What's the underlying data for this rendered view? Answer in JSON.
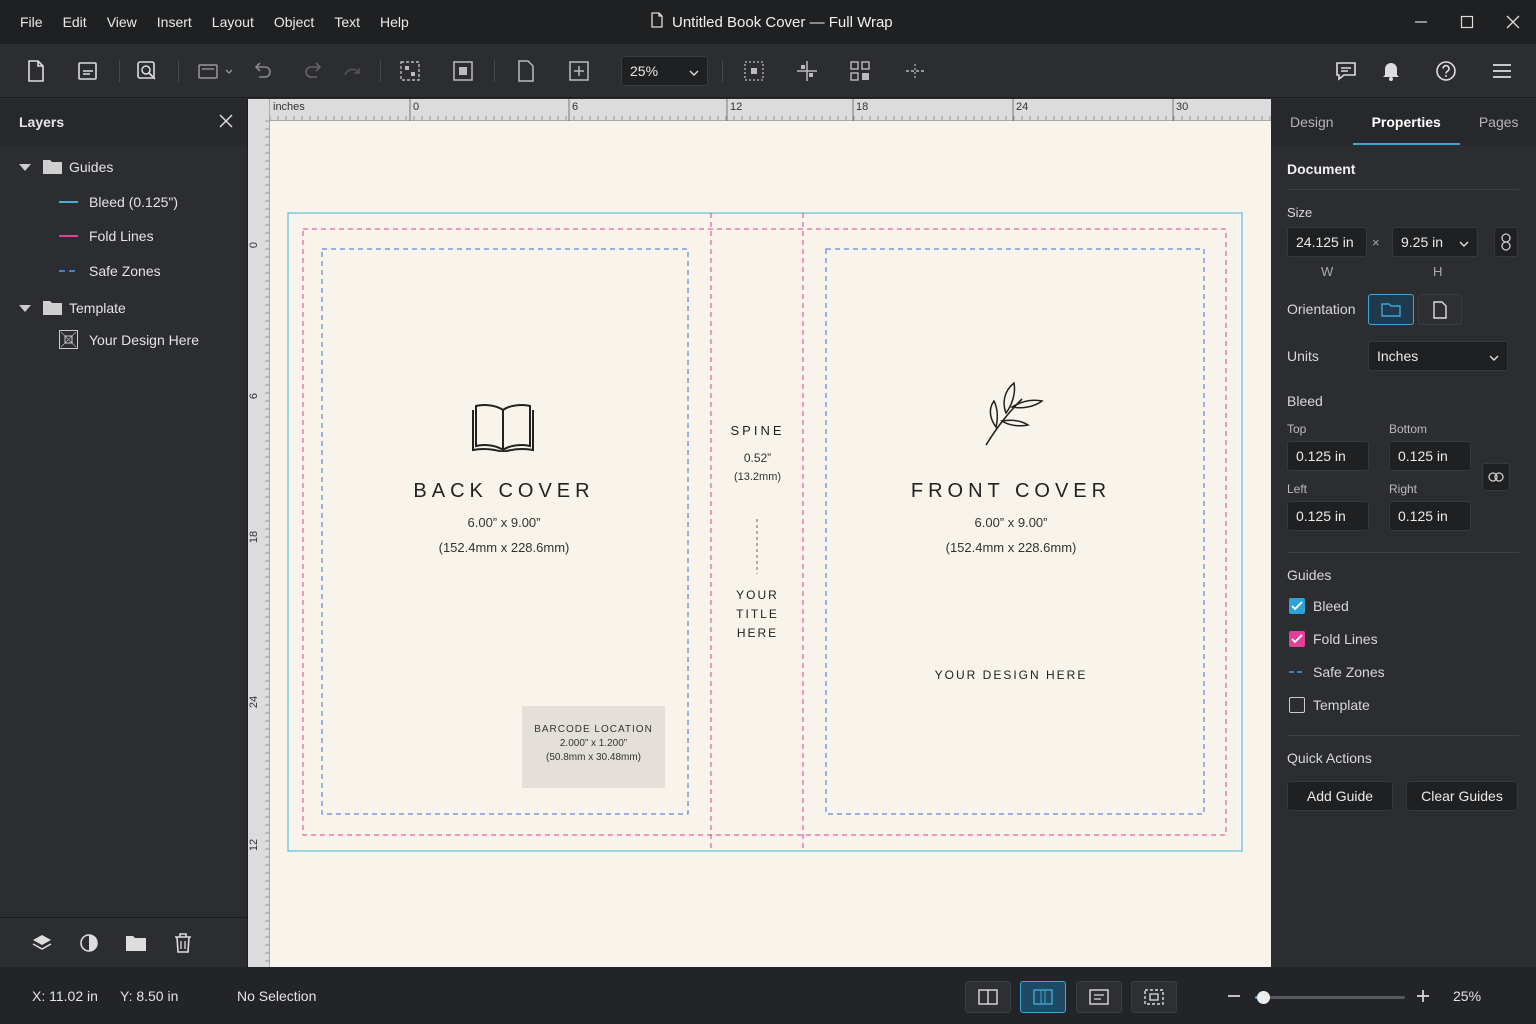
{
  "menu": [
    "File",
    "Edit",
    "View",
    "Insert",
    "Layout",
    "Object",
    "Text",
    "Help"
  ],
  "window": {
    "title": "Untitled Book Cover — Full Wrap"
  },
  "toolbar": {
    "zoom": "25%"
  },
  "layers": {
    "title": "Layers",
    "groups": [
      {
        "name": "Guides",
        "children": [
          "Bleed (0.125\")",
          "Fold Lines",
          "Safe Zones"
        ]
      },
      {
        "name": "Template",
        "children": [
          "Your Design Here"
        ]
      }
    ]
  },
  "ruler": {
    "unit": "inches",
    "top_ticks": [
      "0",
      "6",
      "12",
      "18",
      "24",
      "30"
    ],
    "left_ticks": [
      "0",
      "6",
      "18",
      "24",
      "12"
    ]
  },
  "canvas": {
    "back": {
      "title": "BACK COVER",
      "size": "6.00” x 9.00”",
      "mm": "(152.4mm x 228.6mm)"
    },
    "spine": {
      "title": "SPINE",
      "size": "0.52”",
      "mm": "(13.2mm)",
      "title_lines": [
        "YOUR",
        "TITLE",
        "HERE"
      ]
    },
    "front": {
      "title": "FRONT COVER",
      "size": "6.00” x 9.00”",
      "mm": "(152.4mm x 228.6mm)",
      "design": "YOUR DESIGN HERE"
    },
    "barcode": {
      "title": "BARCODE LOCATION",
      "size": "2.000” x 1.200”",
      "mm": "(50.8mm x 30.48mm)"
    }
  },
  "props": {
    "tabs": [
      "Design",
      "Properties",
      "Pages"
    ],
    "active_tab": "Properties",
    "document_title": "Document",
    "size_label": "Size",
    "width": "24.125 in",
    "height": "9.25 in",
    "w_label": "W",
    "h_label": "H",
    "orientation_label": "Orientation",
    "units_label": "Units",
    "units": "Inches",
    "bleed_title": "Bleed",
    "bleed": {
      "top_label": "Top",
      "top": "0.125 in",
      "bottom_label": "Bottom",
      "bottom": "0.125 in",
      "left_label": "Left",
      "left": "0.125 in",
      "right_label": "Right",
      "right": "0.125 in"
    },
    "guides_title": "Guides",
    "guides": [
      {
        "label": "Bleed",
        "checked": true,
        "color": "#2ea4d6"
      },
      {
        "label": "Fold Lines",
        "checked": true,
        "color": "#e0409a"
      },
      {
        "label": "Safe Zones",
        "checked": null,
        "color": "#3d7fd9"
      },
      {
        "label": "Template",
        "checked": false,
        "color": "#ffffff"
      }
    ],
    "quick_actions_title": "Quick Actions",
    "add_guide": "Add Guide",
    "clear_guides": "Clear Guides"
  },
  "status": {
    "x": "X: 11.02 in",
    "y": "Y: 8.50 in",
    "selection": "No Selection",
    "zoom": "25%",
    "zoom_level": 0.05
  },
  "colors": {
    "bleed": "#3fb3d6",
    "fold": "#e0409a",
    "safe": "#3d6fd9",
    "canvas": "#f8f4eb",
    "accent": "#3fa7d6"
  }
}
